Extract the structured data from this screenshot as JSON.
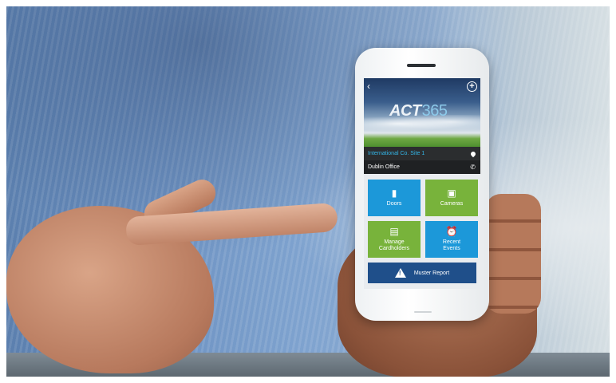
{
  "app": {
    "logo": {
      "brand": "ACT",
      "number": "365"
    },
    "site": "International Co. Site 1",
    "office": "Dublin Office",
    "tiles": [
      {
        "label": "Doors",
        "icon": "door-icon",
        "color": "#1c98d9"
      },
      {
        "label": "Cameras",
        "icon": "camera-icon",
        "color": "#78b33b"
      },
      {
        "label": "Manage\nCardholders",
        "icon": "id-card-icon",
        "color": "#78b33b"
      },
      {
        "label": "Recent\nEvents",
        "icon": "alarm-clock-icon",
        "color": "#1c98d9"
      }
    ],
    "muster_label": "Muster Report",
    "colors": {
      "accent_blue": "#1c98d9",
      "accent_green": "#78b33b",
      "muster_bg": "#1f4f8a",
      "site_text": "#33b6e8"
    }
  }
}
